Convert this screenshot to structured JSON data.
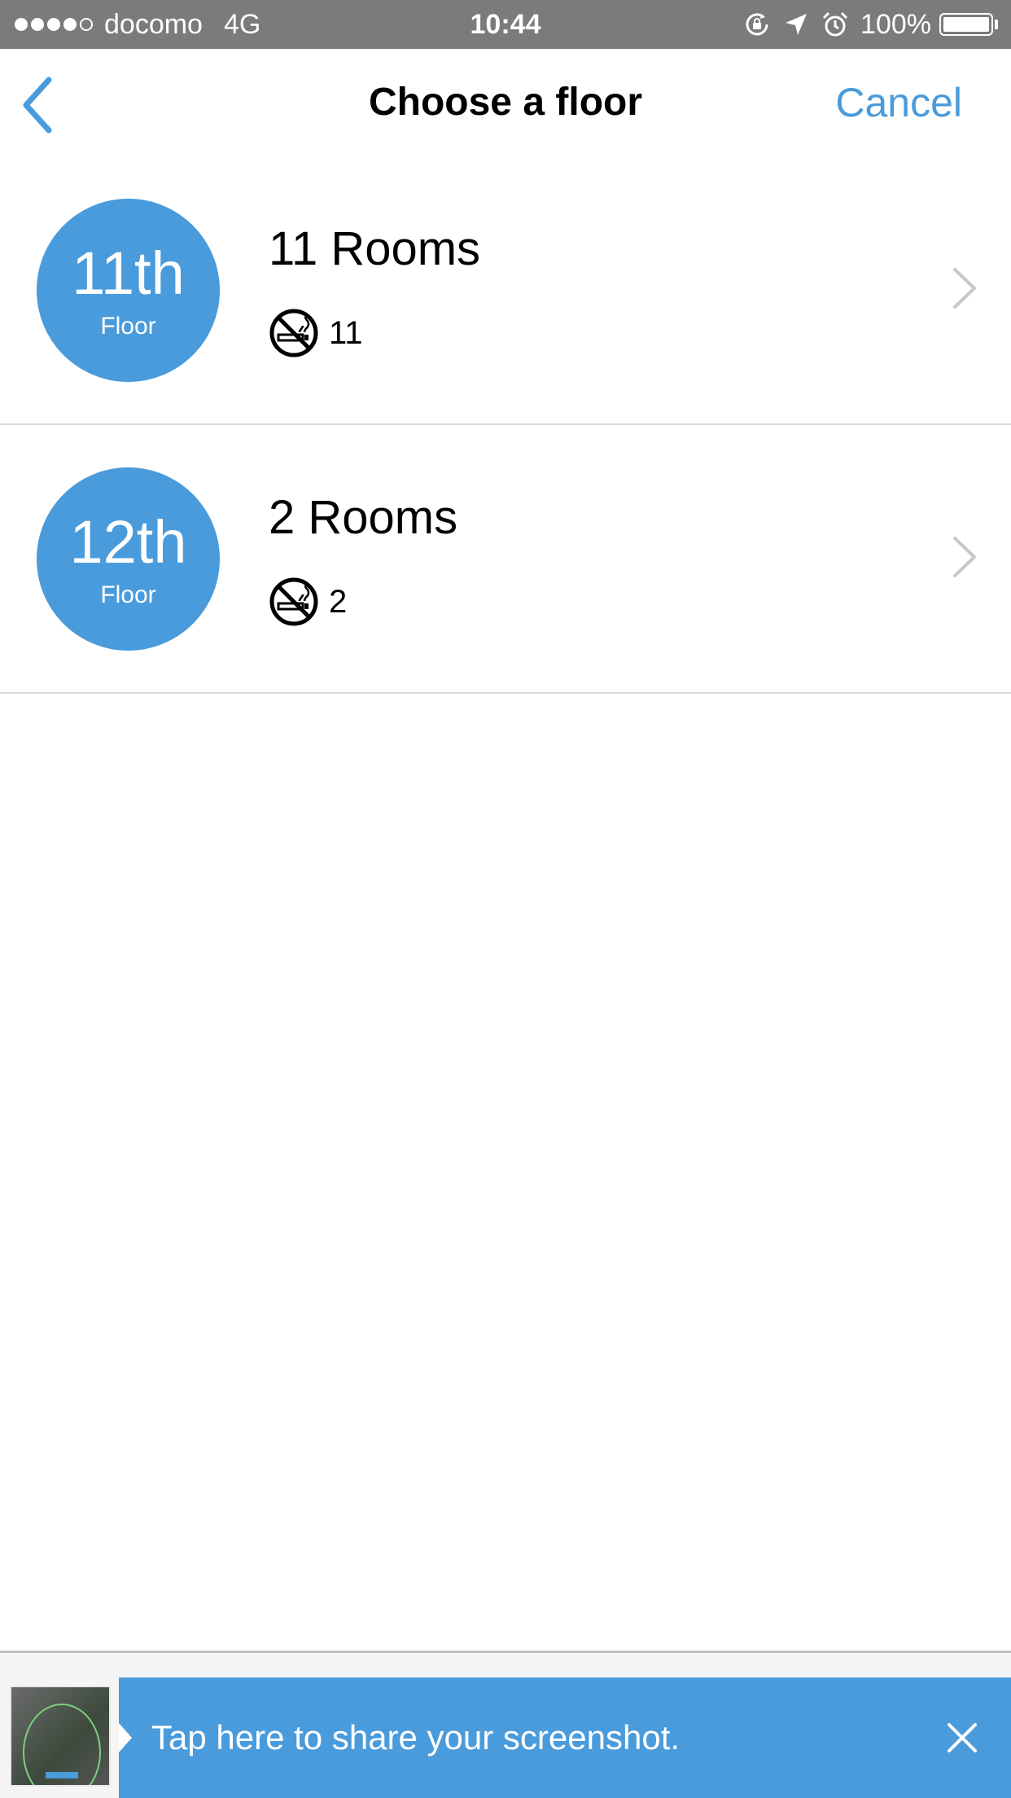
{
  "status_bar": {
    "signal_filled": 4,
    "signal_total": 5,
    "carrier": "docomo",
    "network": "4G",
    "time": "10:44",
    "battery_percent_label": "100%",
    "battery_level": 1.0,
    "icons": [
      "orientation-lock-icon",
      "location-arrow-icon",
      "alarm-clock-icon"
    ]
  },
  "nav": {
    "back_icon": "chevron-left-icon",
    "title": "Choose a floor",
    "cancel_label": "Cancel"
  },
  "floors": [
    {
      "number": "11th",
      "label": "Floor",
      "rooms": "11 Rooms",
      "non_smoking_icon": "no-smoking-icon",
      "non_smoking_count": "11"
    },
    {
      "number": "12th",
      "label": "Floor",
      "rooms": "2 Rooms",
      "non_smoking_icon": "no-smoking-icon",
      "non_smoking_count": "2"
    }
  ],
  "share_banner": {
    "message": "Tap here to share your screenshot.",
    "close_icon": "close-icon"
  },
  "colors": {
    "accent": "#4a9bdb",
    "status_bar": "#7b7b7b",
    "divider": "#dcdcdc"
  }
}
